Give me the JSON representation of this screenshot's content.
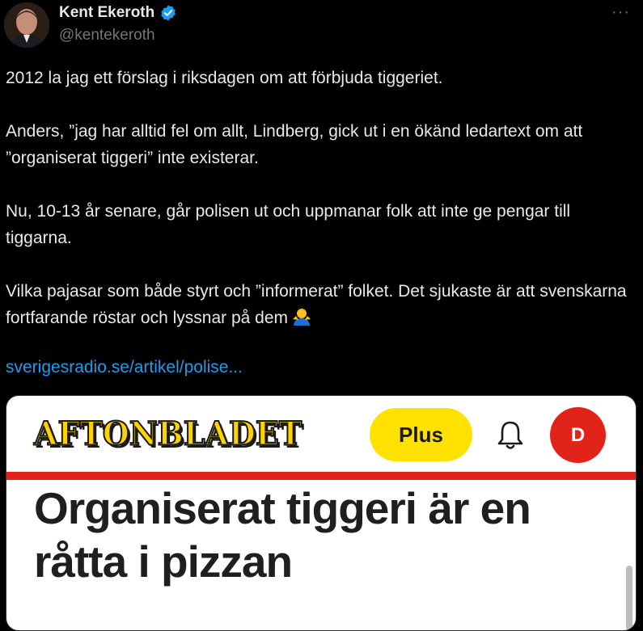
{
  "author": {
    "name": "Kent Ekeroth",
    "handle": "@kentekeroth",
    "verified_color": "#1d9bf0"
  },
  "menu": {
    "more_label": "···"
  },
  "tweet": {
    "paragraphs": [
      "2012 la jag ett förslag i riksdagen om att förbjuda tiggeriet.",
      "Anders, ”jag har alltid fel om allt, Lindberg, gick ut i en ökänd ledartext om att ”organiserat tiggeri” inte existerar.",
      "Nu, 10-13 år senare, går polisen ut och uppmanar folk att inte ge pengar till tiggarna.",
      "Vilka pajasar som både styrt och ”informerat” folket. Det sjukaste är att svenskarna fortfarande röstar och lyssnar på dem"
    ],
    "emoji": "man-shrugging-emoji",
    "link": "sverigesradio.se/artikel/polise..."
  },
  "card": {
    "brand": "AFTONBLADET",
    "plus_label": "Plus",
    "bell_icon": "bell-icon",
    "user_initial": "D",
    "headline": "Organiserat tiggeri är en råtta i pizzan",
    "brand_color": "#ffd200",
    "accent_red": "#e2231a"
  }
}
